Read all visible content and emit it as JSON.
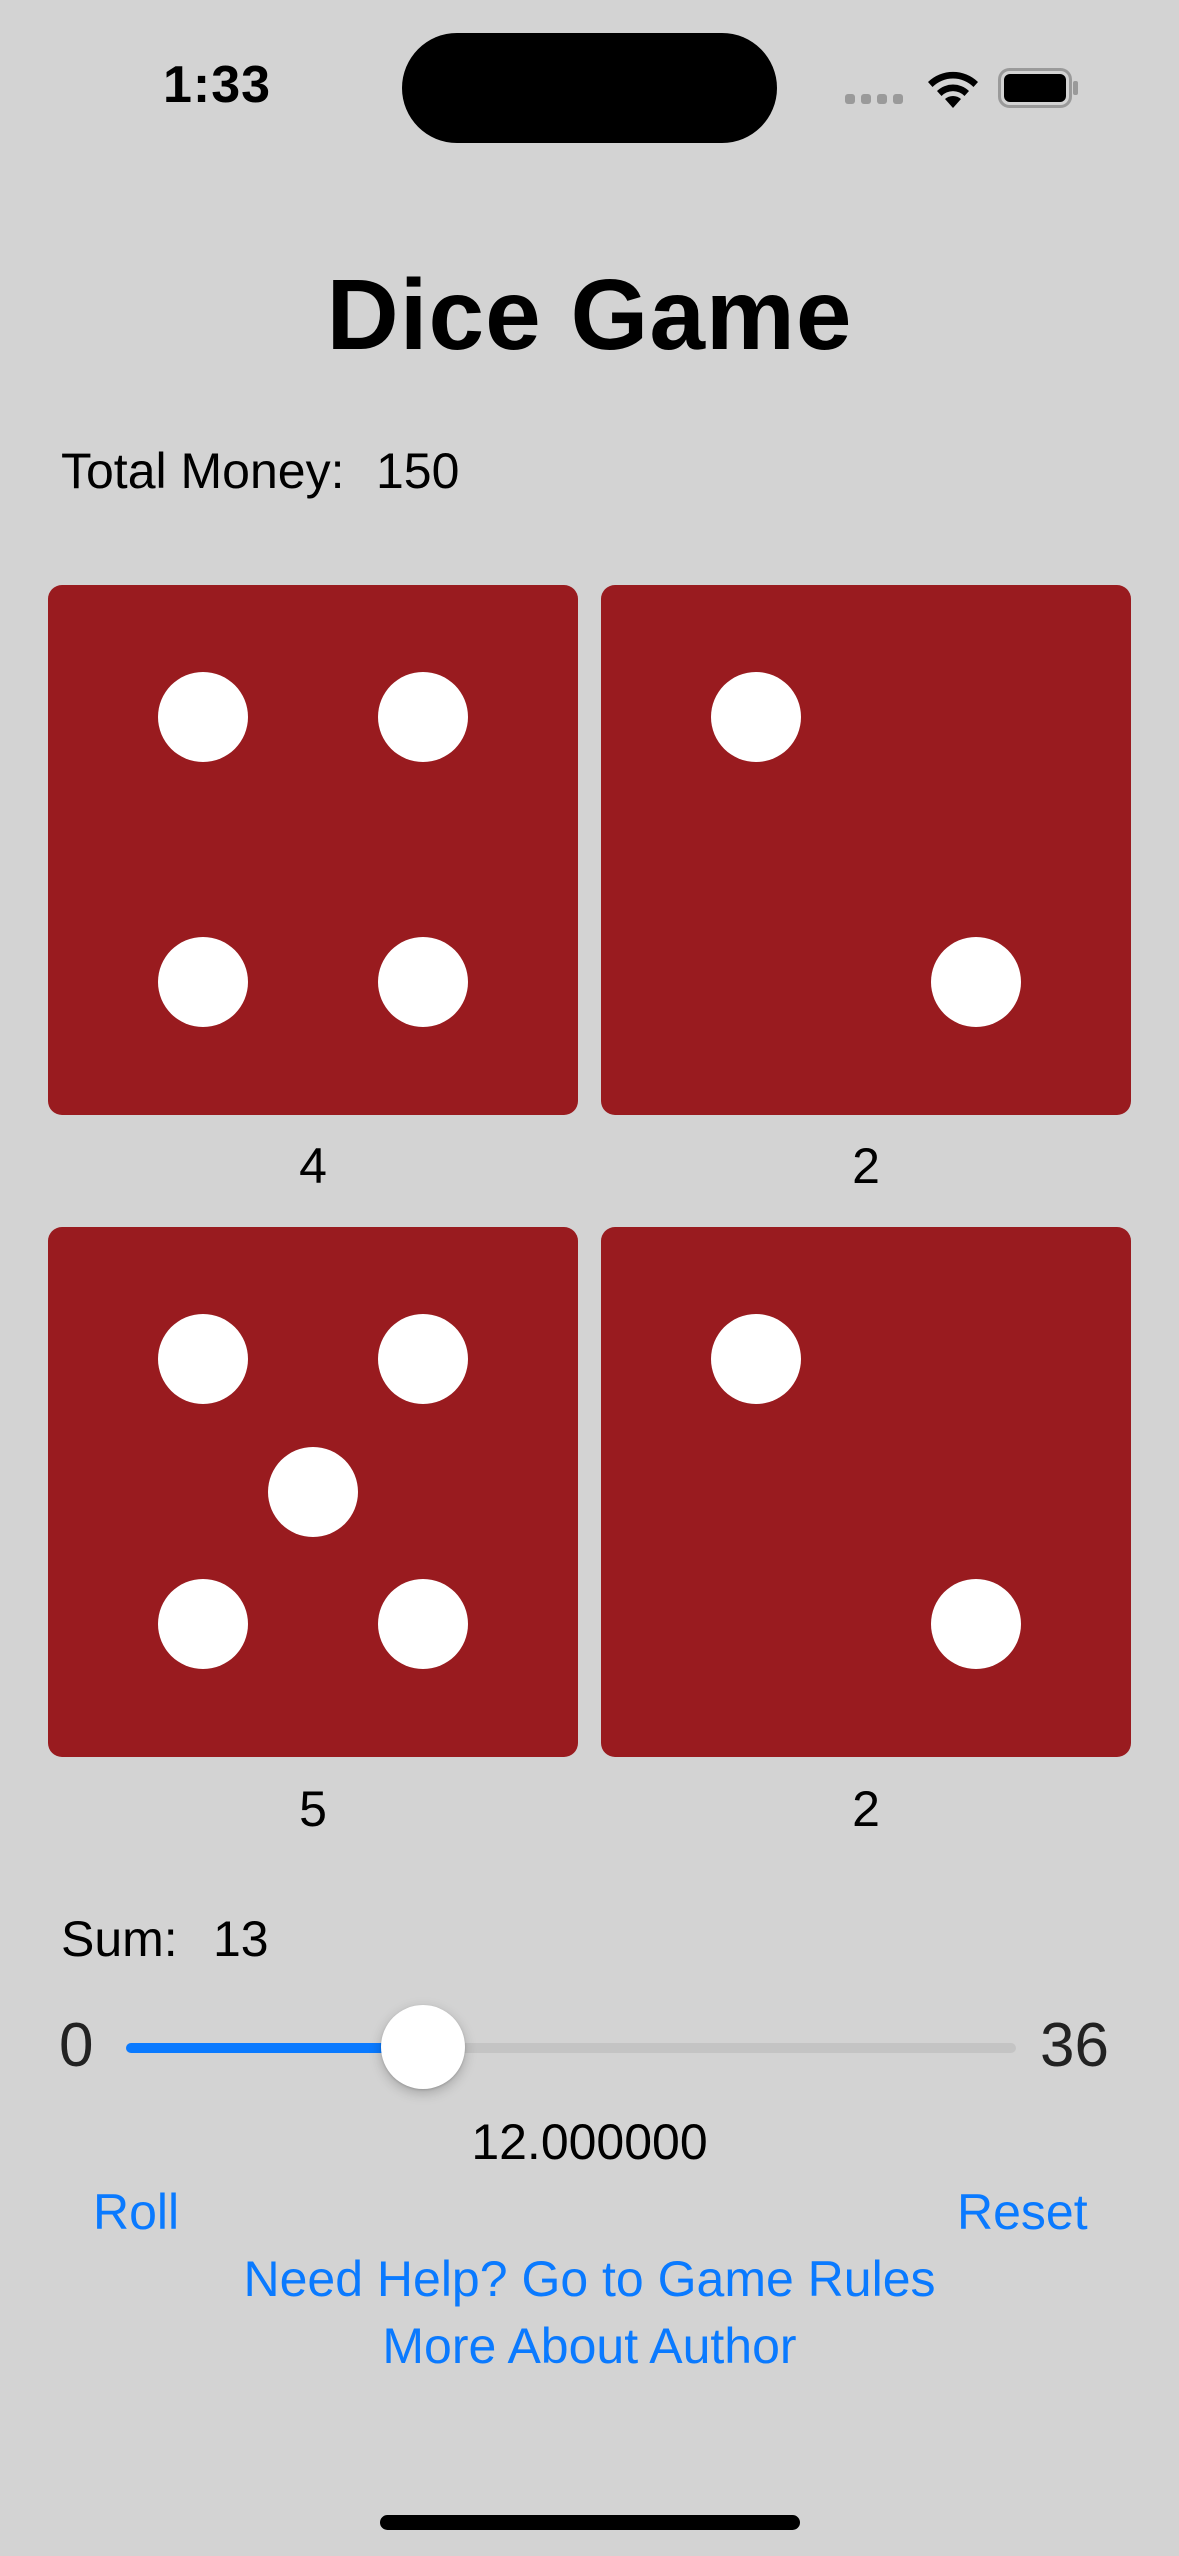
{
  "status_bar": {
    "time": "1:33"
  },
  "header": {
    "title": "Dice Game"
  },
  "money": {
    "label": "Total Money:",
    "value": "150"
  },
  "dice": [
    {
      "value": "4",
      "pips": 4
    },
    {
      "value": "2",
      "pips": 2
    },
    {
      "value": "5",
      "pips": 5
    },
    {
      "value": "2",
      "pips": 2
    }
  ],
  "sum": {
    "label": "Sum:",
    "value": "13"
  },
  "slider": {
    "min": "0",
    "max": "36",
    "value": 12,
    "readout": "12.000000"
  },
  "actions": {
    "roll_label": "Roll",
    "reset_label": "Reset",
    "rules_label": "Need Help? Go to Game Rules",
    "author_label": "More About Author"
  },
  "colors": {
    "die": "#991b1f",
    "pip": "#ffffff",
    "accent": "#0a7aff",
    "background": "#d3d3d3"
  }
}
